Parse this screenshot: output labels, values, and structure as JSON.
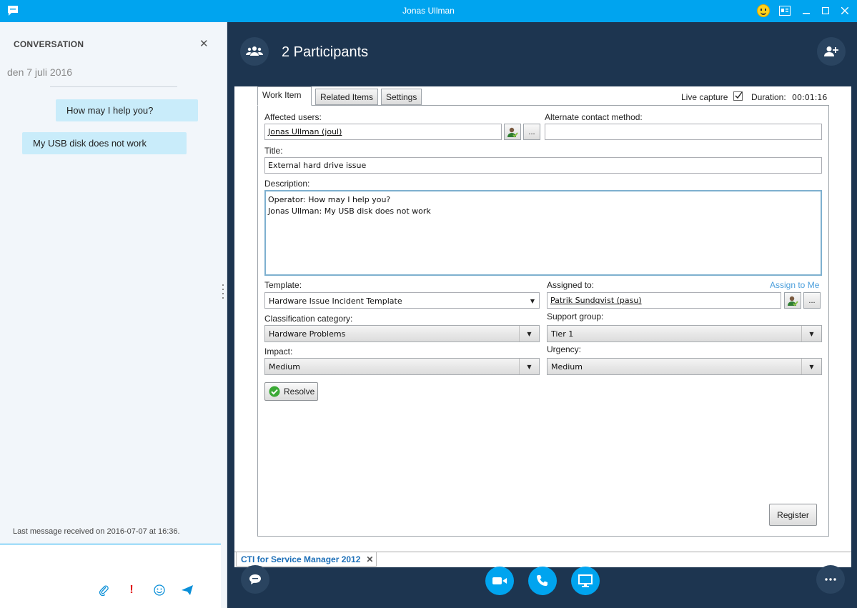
{
  "window": {
    "title": "Jonas Ullman"
  },
  "conversation": {
    "heading": "CONVERSATION",
    "date": "den 7 juli 2016",
    "messages": [
      {
        "text": "How may I help you?",
        "direction": "outgoing"
      },
      {
        "text": "My USB disk does not work",
        "direction": "incoming"
      }
    ],
    "last_message": "Last message received on 2016-07-07 at 16:36."
  },
  "call": {
    "participants_label": "2 Participants"
  },
  "work_item": {
    "tabs": [
      "Work Item",
      "Related Items",
      "Settings"
    ],
    "live_capture_label": "Live capture",
    "live_capture_checked": true,
    "duration_label": "Duration:",
    "duration_value": "00:01:16",
    "affected_users_label": "Affected users:",
    "affected_users_value": "Jonas Ullman (joul)",
    "alternate_contact_label": "Alternate contact method:",
    "alternate_contact_value": "",
    "title_label": "Title:",
    "title_value": "External hard drive issue",
    "description_label": "Description:",
    "description_line1": "Operator: How may I help you?",
    "description_line2": "Jonas Ullman: My USB disk does not work",
    "template_label": "Template:",
    "template_value": "Hardware Issue Incident Template",
    "assigned_to_label": "Assigned to:",
    "assign_to_me": "Assign to Me",
    "assigned_to_value": "Patrik Sundqvist (pasu)",
    "classification_label": "Classification category:",
    "classification_value": "Hardware Problems",
    "support_group_label": "Support group:",
    "support_group_value": "Tier 1",
    "impact_label": "Impact:",
    "impact_value": "Medium",
    "urgency_label": "Urgency:",
    "urgency_value": "Medium",
    "resolve_label": "Resolve",
    "register_label": "Register",
    "ellipsis": "..."
  },
  "bottom_tab": {
    "label": "CTI for Service Manager 2012"
  },
  "colors": {
    "accent": "#00a4ef",
    "dark_bg": "#1d3550",
    "bubble": "#c9ecfa"
  }
}
